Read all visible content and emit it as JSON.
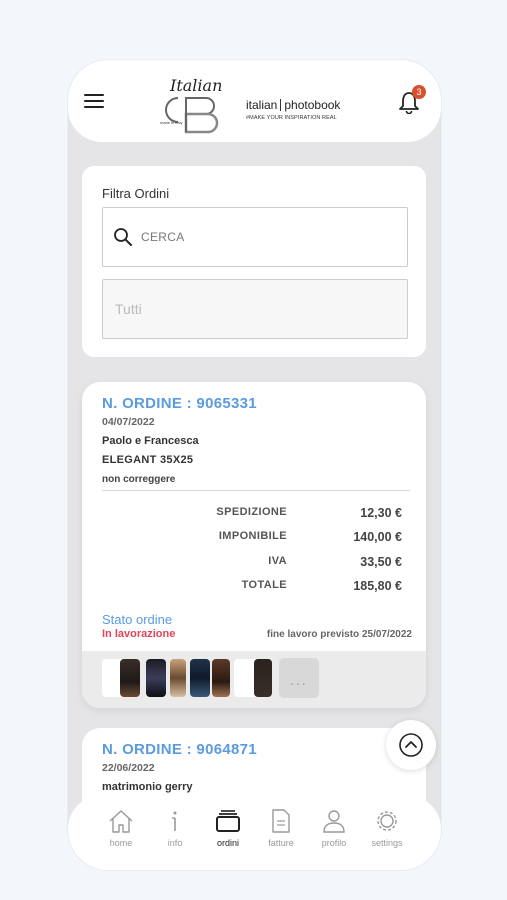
{
  "header": {
    "logo_script": "Italian",
    "logo_small": "made in italy",
    "brand_left": "italian",
    "brand_right": "photobook",
    "tagline": "#MAKE YOUR INSPIRATION REAL",
    "notification_count": "3"
  },
  "filter": {
    "title": "Filtra Ordini",
    "search_placeholder": "CERCA",
    "status_value": "Tutti"
  },
  "order1": {
    "number": "N. ORDINE : 9065331",
    "date": "04/07/2022",
    "customer": "Paolo e Francesca",
    "product": "ELEGANT 35X25",
    "note": "non correggere",
    "rows": [
      {
        "label": "SPEDIZIONE",
        "value": "12,30 €"
      },
      {
        "label": "IMPONIBILE",
        "value": "140,00 €"
      },
      {
        "label": "IVA",
        "value": "33,50 €"
      },
      {
        "label": "TOTALE",
        "value": "185,80 €"
      }
    ],
    "status_label": "Stato ordine",
    "status_value": "In lavorazione",
    "expected_end": "fine lavoro previsto 25/07/2022",
    "more_label": "..."
  },
  "order2": {
    "number": "N. ORDINE : 9064871",
    "date": "22/06/2022",
    "customer": "matrimonio gerry"
  },
  "nav": {
    "home": "home",
    "info": "info",
    "ordini": "ordini",
    "fatture": "fatture",
    "profilo": "profilo",
    "settings": "settings"
  },
  "colors": {
    "accent_blue": "#5b9be0",
    "status_red": "#e0455a",
    "badge": "#d9502b"
  }
}
